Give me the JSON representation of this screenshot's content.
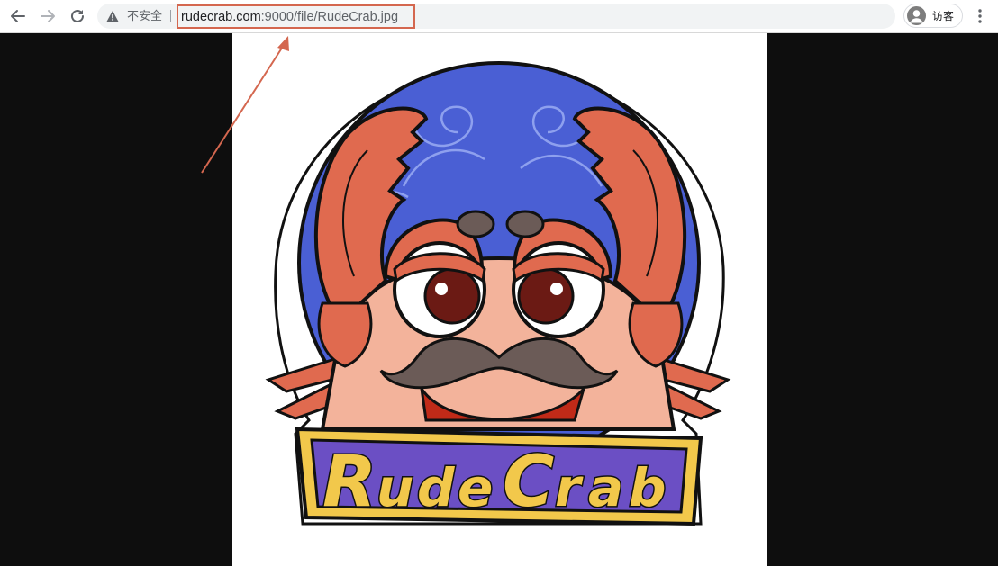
{
  "toolbar": {
    "back_icon": "arrow-left-icon",
    "forward_icon": "arrow-right-icon",
    "reload_icon": "reload-icon"
  },
  "omnibox": {
    "security_icon": "warning-triangle-icon",
    "security_label": "不安全",
    "url_host": "rudecrab.com",
    "url_path": ":9000/file/RudeCrab.jpg",
    "highlight_color": "#d4674f"
  },
  "profile": {
    "label": "访客",
    "icon": "person-icon"
  },
  "menu_icon": "more-vertical-icon",
  "image": {
    "logo_text": "RudeCrab",
    "colors": {
      "crab": "#e06a4f",
      "ocean": "#4a5fd4",
      "banner": "#6b4fc4",
      "letters": "#f2c84b",
      "background": "#0e0e0e"
    }
  },
  "annotation": {
    "arrow_color": "#d4674f"
  }
}
